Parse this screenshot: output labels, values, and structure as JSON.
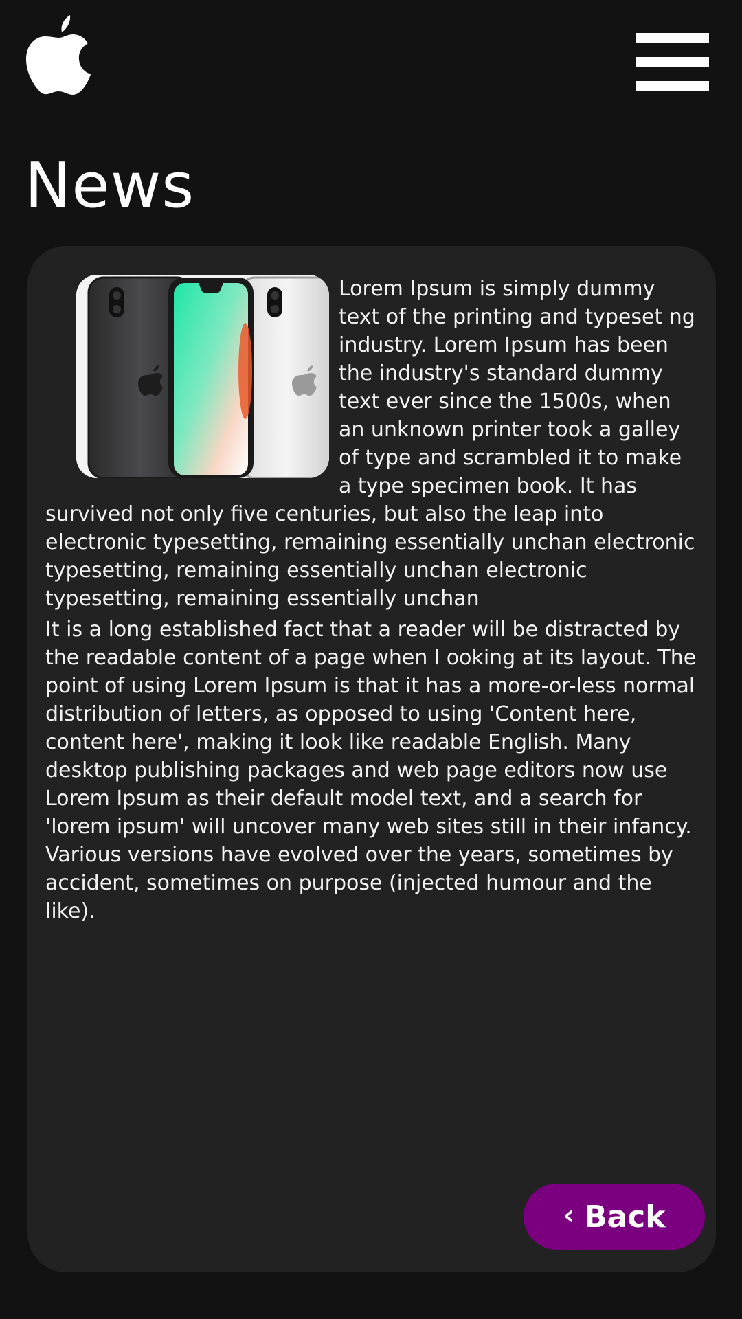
{
  "header": {
    "logo_icon": "apple-logo-icon",
    "menu_icon": "hamburger-menu-icon"
  },
  "page": {
    "title": "News"
  },
  "article": {
    "image_icon": "iphone-product-image",
    "paragraphs": [
      "Lorem Ipsum is simply dummy text of the printing and typeset ng industry. Lorem Ipsum has been the industry's standard dummy text ever since the 1500s, when an unknown printer took a galley of type and scrambled it to make a type specimen book. It has survived not only five centuries, but also the leap into electronic typesetting, remaining essentially unchan electronic typesetting, remaining essentially unchan electronic typesetting, remaining essentially unchan",
      "It is a long established fact that a reader will be distracted by the readable content of a page when l ooking at its layout. The point of using Lorem Ipsum is that it has a more-or-less normal distribution of letters, as opposed to using 'Content here, content here', making it look like readable English. Many desktop publishing packages and web page editors now use Lorem Ipsum as their default model text, and a search for 'lorem ipsum' will uncover many web sites still in their infancy. Various versions have evolved over the years, sometimes by accident, sometimes on purpose (injected humour and the like)."
    ]
  },
  "actions": {
    "back_icon": "chevron-left-icon",
    "back_chevron": "‹",
    "back_label": "Back"
  },
  "colors": {
    "background": "#121212",
    "card": "#222222",
    "accent": "#7a007f",
    "text": "#ffffff"
  }
}
